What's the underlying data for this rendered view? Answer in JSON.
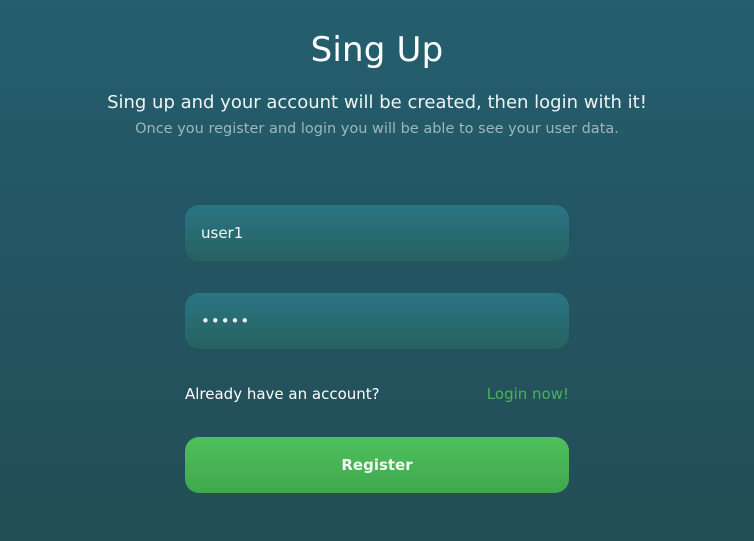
{
  "header": {
    "title": "Sing Up",
    "subtitle": "Sing up and your account will be created, then login with it!",
    "hint": "Once you register and login you will be able to see your user data."
  },
  "form": {
    "username_value": "user1",
    "password_value": "•••••",
    "account_prompt": "Already have an account?",
    "login_link": "Login now!",
    "register_label": "Register"
  },
  "colors": {
    "background_top": "#245f6e",
    "background_bottom": "#234e55",
    "field": "#286a6e",
    "link": "#49b35a",
    "button": "#46b454"
  }
}
